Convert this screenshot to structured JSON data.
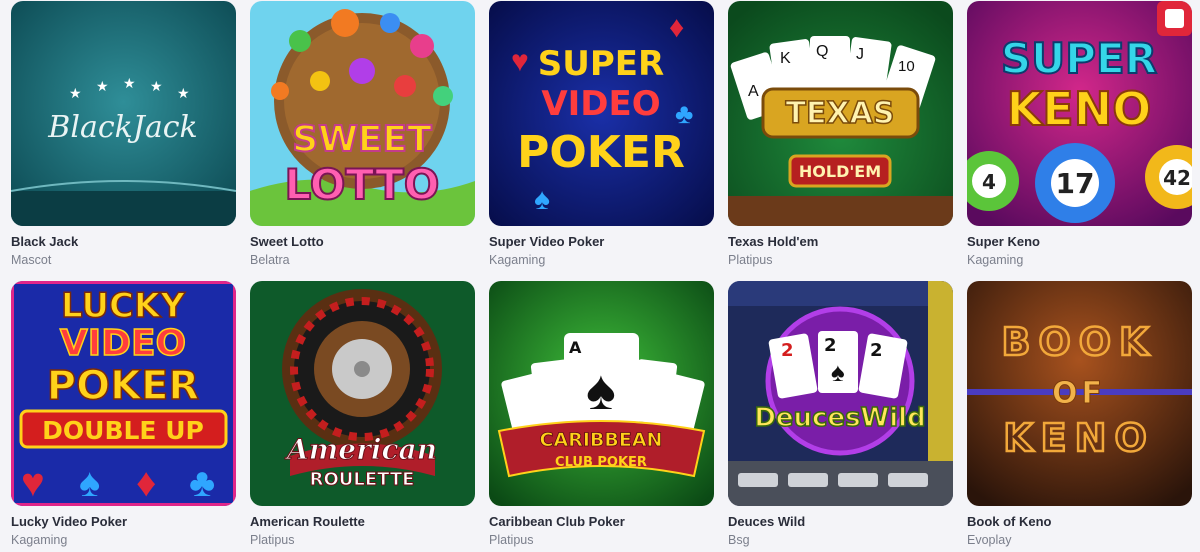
{
  "games": [
    {
      "title": "Black Jack",
      "provider": "Mascot",
      "art_text": [
        "BlackJack"
      ]
    },
    {
      "title": "Sweet Lotto",
      "provider": "Belatra",
      "art_text": [
        "SWEET",
        "LOTTO"
      ]
    },
    {
      "title": "Super Video Poker",
      "provider": "Kagaming",
      "art_text": [
        "SUPER",
        "VIDEO",
        "POKER"
      ]
    },
    {
      "title": "Texas Hold'em",
      "provider": "Platipus",
      "art_text": [
        "TEXAS",
        "HOLD'EM"
      ]
    },
    {
      "title": "Super Keno",
      "provider": "Kagaming",
      "art_text": [
        "SUPER",
        "KENO",
        "4",
        "17",
        "42"
      ]
    },
    {
      "title": "Lucky Video Poker",
      "provider": "Kagaming",
      "art_text": [
        "LUCKY",
        "VIDEO",
        "POKER",
        "DOUBLE UP"
      ]
    },
    {
      "title": "American Roulette",
      "provider": "Platipus",
      "art_text": [
        "American",
        "ROULETTE"
      ]
    },
    {
      "title": "Caribbean Club Poker",
      "provider": "Platipus",
      "art_text": [
        "CARIBBEAN",
        "CLUB POKER"
      ]
    },
    {
      "title": "Deuces Wild",
      "provider": "Bsg",
      "art_text": [
        "DeucesWild",
        "2",
        "2",
        "2"
      ]
    },
    {
      "title": "Book of Keno",
      "provider": "Evoplay",
      "art_text": [
        "BOOK",
        "OF",
        "KENO"
      ]
    }
  ],
  "colors": {
    "background": "#f4f4f8",
    "title": "#2a2d3a",
    "provider": "#7b7f8c"
  },
  "icons": [
    "spade-icon",
    "heart-icon",
    "diamond-icon",
    "club-icon",
    "dice-badge-icon"
  ]
}
